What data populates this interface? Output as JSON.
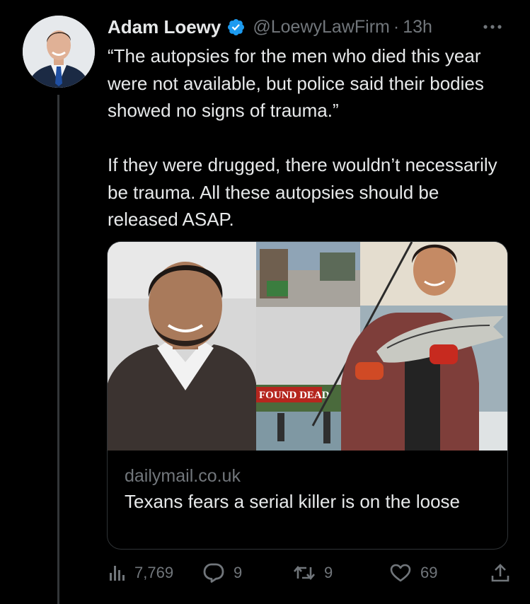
{
  "author": {
    "name": "Adam Loewy",
    "handle": "@LoewyLawFirm",
    "separator": "·",
    "time": "13h",
    "verified_color": "#1d9bf0"
  },
  "tweet": {
    "text": "“The autopsies for the men who died this year were not available, but police said their bodies showed no signs of trauma.”\n\nIf they were drugged, there wouldn’t necessarily be trauma. All these autopsies should be released ASAP."
  },
  "card": {
    "domain": "dailymail.co.uk",
    "title": "Texans fears a serial killer is on the loose",
    "image_caption": "FOUND DEAD"
  },
  "metrics": {
    "views": "7,769",
    "replies": "9",
    "retweets": "9",
    "likes": "69"
  },
  "icons": [
    "verified-badge-icon",
    "more-icon",
    "views-icon",
    "reply-icon",
    "retweet-icon",
    "like-icon",
    "share-icon"
  ]
}
